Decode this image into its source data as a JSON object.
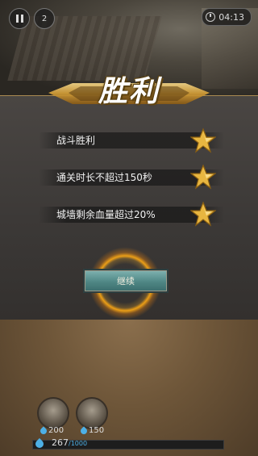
{
  "hud": {
    "timer": "04:13",
    "pause_icon": "pause-icon",
    "speed_label": "2"
  },
  "result": {
    "title": "胜利"
  },
  "objectives": [
    {
      "label": "战斗胜利",
      "achieved": true
    },
    {
      "label": "通关时长不超过150秒",
      "achieved": true
    },
    {
      "label": "城墙剩余血量超过20%",
      "achieved": true
    }
  ],
  "continue_label": "继续",
  "units": [
    {
      "cost": "200"
    },
    {
      "cost": "150"
    }
  ],
  "energy": {
    "current": "267",
    "max": "/1000"
  },
  "colors": {
    "gold": "#e8b640",
    "accent_teal": "#4f8785",
    "energy_blue": "#4db0e6"
  }
}
